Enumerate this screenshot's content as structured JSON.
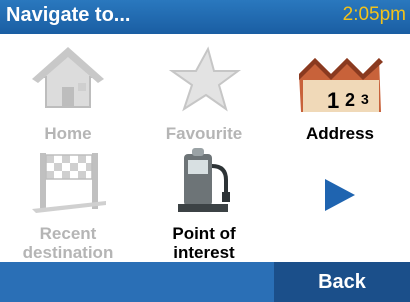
{
  "header": {
    "title": "Navigate to...",
    "time": "2:05pm"
  },
  "tiles": [
    {
      "label": "Home",
      "icon": "home-icon",
      "enabled": false
    },
    {
      "label": "Favourite",
      "icon": "star-icon",
      "enabled": false
    },
    {
      "label": "Address",
      "icon": "address-houses-icon",
      "enabled": true
    },
    {
      "label": "Recent\ndestination",
      "icon": "checkered-flag-icon",
      "enabled": false
    },
    {
      "label": "Point of\ninterest",
      "icon": "gas-pump-icon",
      "enabled": true
    },
    {
      "label": "",
      "icon": "next-arrow-icon",
      "enabled": true
    }
  ],
  "footer": {
    "back_label": "Back"
  },
  "colors": {
    "titlebar": "#1f6bb5",
    "clock": "#f2c21a",
    "footer": "#2a6fb6",
    "back": "#1b4f8a",
    "arrow": "#1f64b0"
  }
}
